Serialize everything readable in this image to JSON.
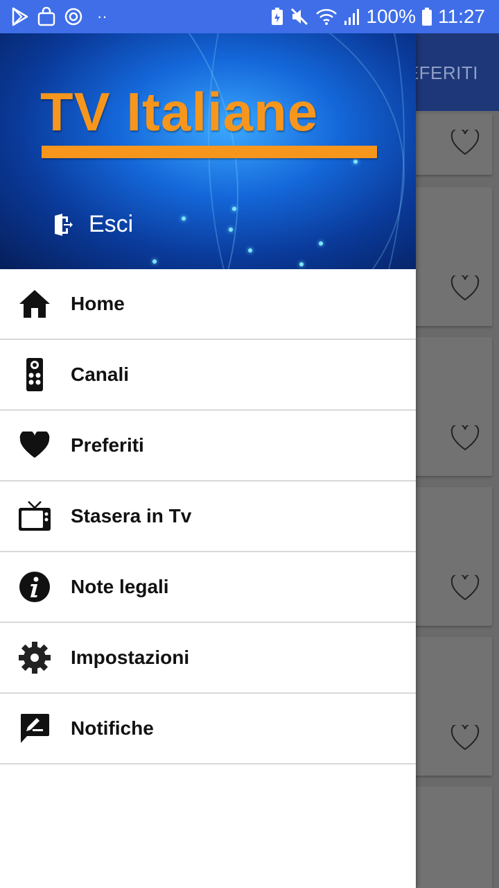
{
  "status_bar": {
    "dots": "··",
    "battery_percent": "100%",
    "time": "11:27",
    "icons": [
      "play-store-icon",
      "shopping-bag-icon",
      "sync-icon",
      "battery-saver-icon",
      "mute-icon",
      "wifi-icon",
      "signal-icon",
      "battery-icon"
    ]
  },
  "background_app": {
    "title_fragment": "EFERITI",
    "list_item_icon": "heart-outline-icon"
  },
  "drawer": {
    "header": {
      "app_logo_text": "TV Italiane",
      "logout_label": "Esci",
      "logout_icon": "exit-door-icon"
    },
    "items": [
      {
        "label": "Home",
        "icon": "home-icon"
      },
      {
        "label": "Canali",
        "icon": "remote-control-icon"
      },
      {
        "label": "Preferiti",
        "icon": "heart-icon"
      },
      {
        "label": "Stasera in Tv",
        "icon": "tv-icon"
      },
      {
        "label": "Note legali",
        "icon": "info-icon"
      },
      {
        "label": "Impostazioni",
        "icon": "gear-icon"
      },
      {
        "label": "Notifiche",
        "icon": "feedback-edit-icon"
      }
    ]
  },
  "colors": {
    "status_bar": "#3f6ee8",
    "logo_orange": "#f7961d",
    "app_bar_dimmed": "#1e3778",
    "scrim": "#6a6a6a"
  }
}
